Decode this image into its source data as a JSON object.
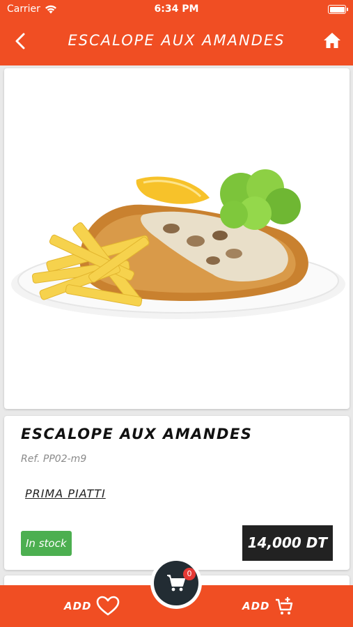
{
  "status_bar": {
    "carrier": "Carrier",
    "time": "6:34 PM"
  },
  "header": {
    "title": "ESCALOPE AUX AMANDES"
  },
  "product": {
    "image_alt": "Breaded escalope with fries, mushroom sauce, lemon and lettuce",
    "name": "ESCALOPE AUX AMANDES",
    "ref": "Ref. PP02-m9",
    "category": "PRIMA PIATTI",
    "stock": "In stock",
    "price": "14,000 DT"
  },
  "bottom_bar": {
    "add_favorite_label": "ADD",
    "add_cart_label": "ADD",
    "cart_count": "0"
  },
  "colors": {
    "brand": "#f04e23",
    "stock": "#4caf50",
    "price_bg": "#222222"
  }
}
